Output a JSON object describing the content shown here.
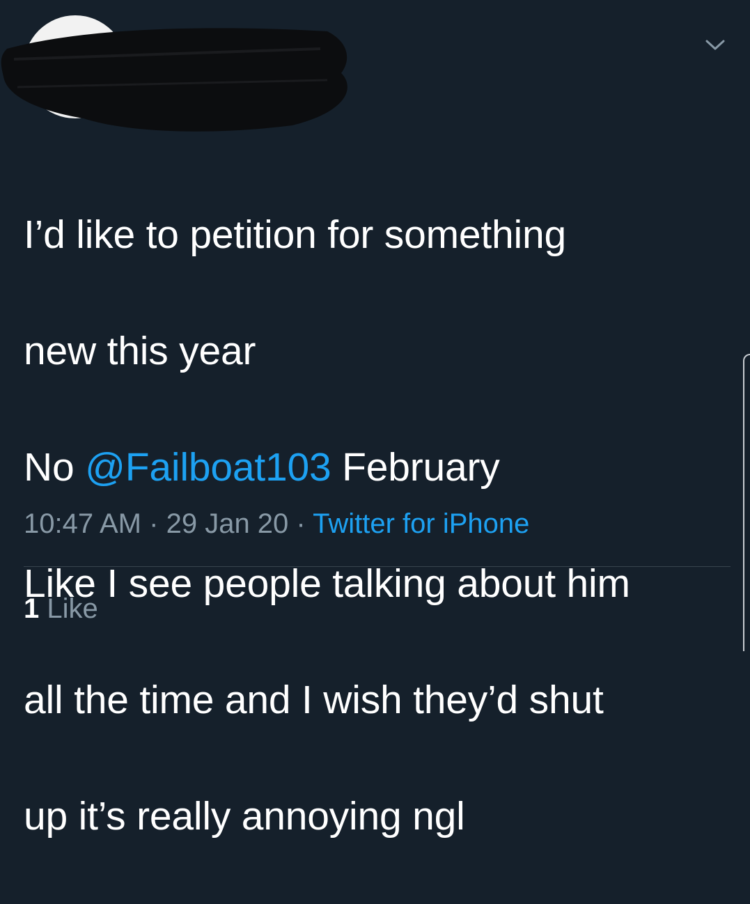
{
  "tweet": {
    "text_lines": [
      "I’d like to petition for something",
      "new this year",
      {
        "before": "No ",
        "mention": "@Failboat103",
        "after": " February"
      },
      "Like I see people talking about him",
      "all the time and I wish they’d shut",
      "up it’s really annoying ngl"
    ],
    "time": "10:47 AM",
    "separator": "·",
    "date": "29 Jan 20",
    "source": "Twitter for iPhone",
    "likes_count": "1",
    "likes_label": "Like"
  },
  "icons": {
    "menu": "chevron-down-icon",
    "avatar": "avatar"
  },
  "colors": {
    "background": "#15202b",
    "text": "#ffffff",
    "secondary": "#8899a6",
    "accent": "#1da1f2",
    "divider": "#38444d"
  }
}
